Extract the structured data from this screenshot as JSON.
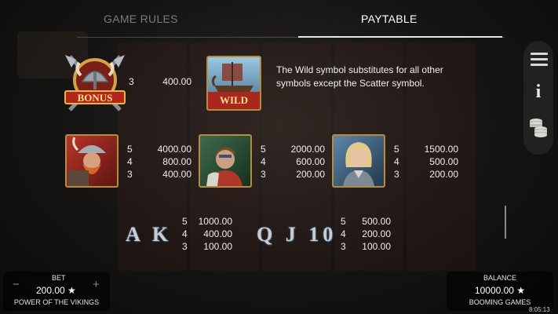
{
  "tabs": {
    "rules": "GAME RULES",
    "paytable": "PAYTABLE"
  },
  "colors": {
    "background": "#161413",
    "accent_gold": "#b58b3e",
    "text": "#ffffff",
    "muted_tab": "#7d7b78"
  },
  "side_menu": {
    "icons": [
      "hamburger-menu-icon",
      "info-icon",
      "coin-stack-icon"
    ],
    "info_glyph": "i"
  },
  "paytable": {
    "bonus": {
      "symbol_label": "BONUS",
      "pays": [
        {
          "count": "3",
          "value": "400.00"
        }
      ]
    },
    "wild": {
      "symbol_label": "WILD",
      "description": "The Wild symbol substitutes for all other symbols except the Scatter symbol."
    },
    "high": [
      {
        "pays": [
          {
            "count": "5",
            "value": "4000.00"
          },
          {
            "count": "4",
            "value": "800.00"
          },
          {
            "count": "3",
            "value": "400.00"
          }
        ]
      },
      {
        "pays": [
          {
            "count": "5",
            "value": "2000.00"
          },
          {
            "count": "4",
            "value": "600.00"
          },
          {
            "count": "3",
            "value": "200.00"
          }
        ]
      },
      {
        "pays": [
          {
            "count": "5",
            "value": "1500.00"
          },
          {
            "count": "4",
            "value": "500.00"
          },
          {
            "count": "3",
            "value": "200.00"
          }
        ]
      }
    ],
    "low": [
      {
        "letters": "A K",
        "pays": [
          {
            "count": "5",
            "value": "1000.00"
          },
          {
            "count": "4",
            "value": "400.00"
          },
          {
            "count": "3",
            "value": "100.00"
          }
        ]
      },
      {
        "letters": "Q J 10",
        "pays": [
          {
            "count": "5",
            "value": "500.00"
          },
          {
            "count": "4",
            "value": "200.00"
          },
          {
            "count": "3",
            "value": "100.00"
          }
        ]
      }
    ]
  },
  "bottom": {
    "bet_label": "BET",
    "bet_value": "200.00 ★",
    "minus": "−",
    "plus": "+",
    "game_name": "POWER OF THE VIKINGS",
    "balance_label": "BALANCE",
    "balance_value": "10000.00 ★",
    "brand": "BOOMING GAMES",
    "clock": "8:05:13"
  }
}
